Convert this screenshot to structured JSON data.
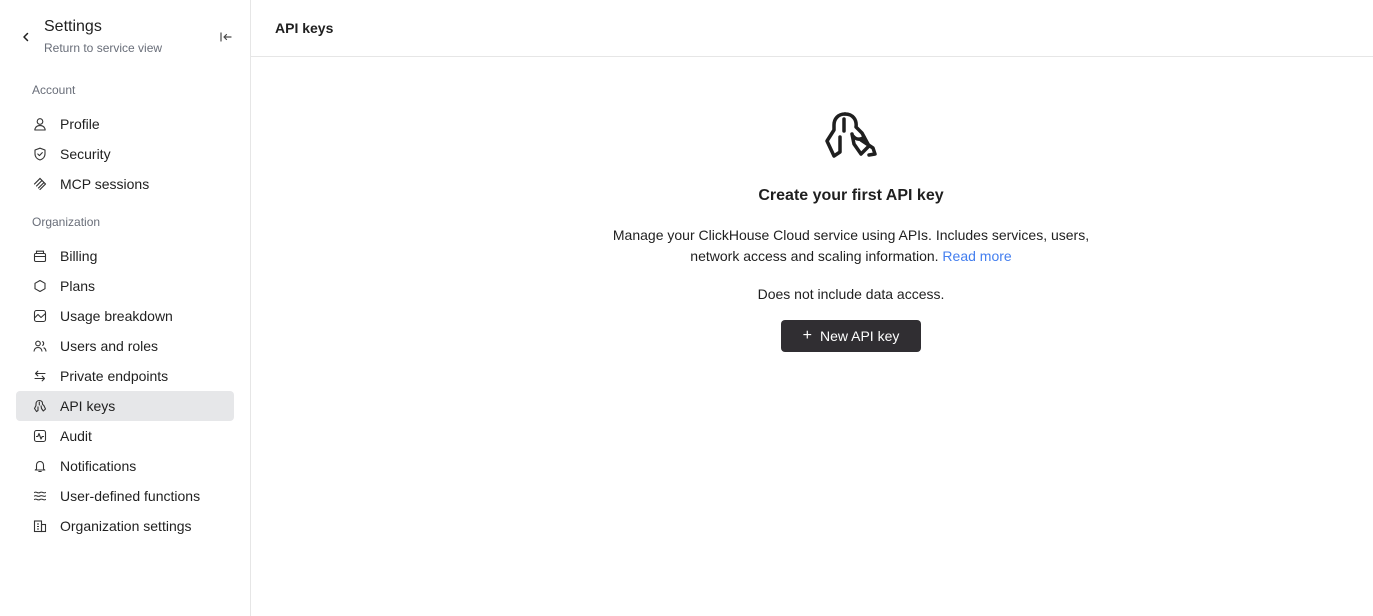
{
  "sidebar": {
    "title": "Settings",
    "subtitle": "Return to service view",
    "sections": [
      {
        "label": "Account"
      },
      {
        "label": "Organization"
      }
    ],
    "items": [
      {
        "label": "Profile",
        "icon": "user-icon"
      },
      {
        "label": "Security",
        "icon": "shield-icon"
      },
      {
        "label": "MCP sessions",
        "icon": "mcp-icon"
      },
      {
        "label": "Billing",
        "icon": "billing-icon"
      },
      {
        "label": "Plans",
        "icon": "hexagon-icon"
      },
      {
        "label": "Usage breakdown",
        "icon": "chart-icon"
      },
      {
        "label": "Users and roles",
        "icon": "users-icon"
      },
      {
        "label": "Private endpoints",
        "icon": "arrows-icon"
      },
      {
        "label": "API keys",
        "icon": "keys-icon",
        "active": true
      },
      {
        "label": "Audit",
        "icon": "audit-icon"
      },
      {
        "label": "Notifications",
        "icon": "bell-icon"
      },
      {
        "label": "User-defined functions",
        "icon": "waves-icon"
      },
      {
        "label": "Organization settings",
        "icon": "building-icon"
      }
    ]
  },
  "header": {
    "title": "API keys"
  },
  "empty_state": {
    "title": "Create your first API key",
    "description": "Manage your ClickHouse Cloud service using APIs. Includes services, users, network access and scaling information.",
    "read_more": "Read more",
    "note": "Does not include data access.",
    "button_label": "New API key"
  },
  "colors": {
    "accent_link": "#437eef",
    "button_bg": "#302e32",
    "active_item_bg": "#e6e7e9"
  }
}
